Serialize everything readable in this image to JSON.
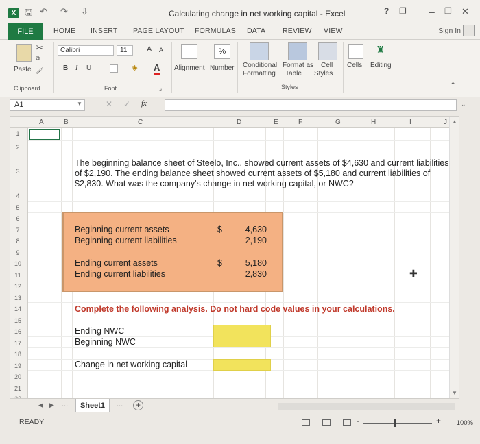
{
  "window": {
    "title": "Calculating change in net working capital - Excel",
    "help": "?",
    "minimize": "–",
    "restore": "❐",
    "close": "✕"
  },
  "ribbon_tabs": {
    "file": "FILE",
    "tabs": [
      "HOME",
      "INSERT",
      "PAGE LAYOUT",
      "FORMULAS",
      "DATA",
      "REVIEW",
      "VIEW"
    ],
    "sign_in": "Sign In"
  },
  "ribbon": {
    "paste": "Paste",
    "clipboard": "Clipboard",
    "font_name": "Calibri",
    "font_size": "11",
    "font_group": "Font",
    "bold": "B",
    "italic": "I",
    "underline": "U",
    "alignment": "Alignment",
    "number": "Number",
    "conditional_formatting": [
      "Conditional",
      "Formatting"
    ],
    "format_as_table": [
      "Format as",
      "Table"
    ],
    "cell_styles": [
      "Cell",
      "Styles"
    ],
    "styles_group": "Styles",
    "cells": "Cells",
    "editing": "Editing",
    "font_grow": "A",
    "font_shrink": "A",
    "percent": "%"
  },
  "formula_bar": {
    "name_box": "A1",
    "fx": "fx",
    "cancel": "✕",
    "enter": "✓",
    "value": ""
  },
  "grid": {
    "columns": [
      "A",
      "B",
      "C",
      "D",
      "E",
      "F",
      "G",
      "H",
      "I",
      "J"
    ],
    "rows": [
      "1",
      "2",
      "3",
      "4",
      "5",
      "6",
      "7",
      "8",
      "9",
      "10",
      "11",
      "12",
      "13",
      "14",
      "15",
      "16",
      "17",
      "18",
      "19",
      "20",
      "21",
      "22"
    ],
    "question": "The beginning balance sheet of Steelo, Inc., showed current assets of $4,630 and current liabilities of $2,190. The ending balance sheet showed current assets of $5,180 and current liabilities of $2,830. What was the company's change in net working capital, or NWC?",
    "beginning_assets_label": "Beginning current assets",
    "beginning_liabilities_label": "Beginning current liabilities",
    "beginning_assets_value": "4,630",
    "beginning_liabilities_value": "2,190",
    "ending_assets_label": "Ending current assets",
    "ending_liabilities_label": "Ending current liabilities",
    "ending_assets_value": "5,180",
    "ending_liabilities_value": "2,830",
    "dollar": "$",
    "instruction": "Complete the following analysis. Do not hard code values in your calculations.",
    "ending_nwc_label": "Ending NWC",
    "beginning_nwc_label": "Beginning NWC",
    "change_nwc_label": "Change in net working capital"
  },
  "sheets": {
    "active": "Sheet1",
    "more": "...",
    "add": "+"
  },
  "status": {
    "ready": "READY",
    "zoom": "100%",
    "zoom_minus": "-",
    "zoom_plus": "+"
  },
  "colors": {
    "excel_green": "#1f7a43",
    "input_box": "#f4b183",
    "answer_cell": "#f2e35c",
    "instruction_red": "#c0392b"
  }
}
